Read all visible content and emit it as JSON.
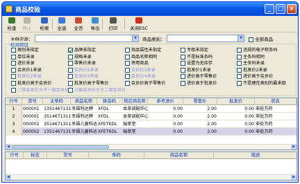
{
  "window": {
    "title": "商品校验",
    "buttons": {
      "minimize": "_",
      "maximize": "□",
      "close": "×"
    }
  },
  "toolbar": {
    "items": [
      {
        "label": "检查",
        "icon": "check-icon",
        "color": "#3a7a2a",
        "enabled": true
      },
      {
        "label": "停止",
        "icon": "stop-icon",
        "color": "#b8b5a6",
        "enabled": false
      },
      {
        "label": "检索",
        "icon": "search-icon",
        "color": "#2f62c7",
        "enabled": true
      },
      {
        "label": "全选",
        "icon": "select-all-icon",
        "color": "#3c7ad8",
        "enabled": true
      },
      {
        "label": "全否",
        "icon": "deselect-all-icon",
        "color": "#c94a3a",
        "enabled": true
      },
      {
        "label": "导出",
        "icon": "export-icon",
        "color": "#3f8fd0",
        "enabled": true
      },
      {
        "label": "打印",
        "icon": "print-icon",
        "color": "#555555",
        "enabled": true
      },
      {
        "label": "关闭ESC",
        "icon": "close-circle-icon",
        "color": "#d03020",
        "enabled": true
      }
    ]
  },
  "filters": {
    "supplier_label": "主供应商：",
    "supplier_value": "",
    "category_label": "商品类别：",
    "category_value": "",
    "all_goods_label": "全部商品",
    "all_goods_checked": false
  },
  "check_items": {
    "title": "检测项目",
    "options": [
      {
        "label": "类别未指定",
        "checked": false,
        "dim": false
      },
      {
        "label": "品牌未指定",
        "checked": true,
        "dim": false
      },
      {
        "label": "商品属性未指定",
        "checked": false,
        "dim": false
      },
      {
        "label": "专柜未指定",
        "checked": false,
        "dim": false
      },
      {
        "label": "违规的电子称条码",
        "checked": false,
        "dim": false
      },
      {
        "label": "单位未录",
        "checked": false,
        "dim": false
      },
      {
        "label": "规格未录",
        "checked": false,
        "dim": false
      },
      {
        "label": "商品名称相同",
        "checked": false,
        "dim": false
      },
      {
        "label": "不是标准条码",
        "checked": false,
        "dim": false
      },
      {
        "label": "主条码相同",
        "checked": false,
        "dim": false
      },
      {
        "label": "进价未录",
        "checked": false,
        "dim": false
      },
      {
        "label": "零售价未录",
        "checked": false,
        "dim": false
      },
      {
        "label": "停用商品",
        "checked": false,
        "dim": false
      },
      {
        "label": "设置为无库存",
        "checked": false,
        "dim": false
      },
      {
        "label": "主条码未录",
        "checked": false,
        "dim": false
      },
      {
        "label": "会员价1未录",
        "checked": false,
        "dim": false
      },
      {
        "label": "会员价2未录",
        "checked": false,
        "dim": true
      },
      {
        "label": "会员价3未录",
        "checked": false,
        "dim": true
      },
      {
        "label": "批发价1未录",
        "checked": false,
        "dim": false
      },
      {
        "label": "批发价2未录",
        "checked": false,
        "dim": false
      },
      {
        "label": "批发价2未录",
        "checked": false,
        "dim": true
      },
      {
        "label": "批发价3未录",
        "checked": false,
        "dim": true
      },
      {
        "label": "会员价4未录",
        "checked": false,
        "dim": true
      },
      {
        "label": "进价高于零售价",
        "checked": false,
        "dim": false
      },
      {
        "label": "进价高于会员价",
        "checked": false,
        "dim": false
      },
      {
        "label": "批发价高于会员价",
        "checked": false,
        "dim": false
      },
      {
        "label": "批发价高于零售价",
        "checked": false,
        "dim": false
      },
      {
        "label": "会员价高于零售价",
        "checked": false,
        "dim": false
      },
      {
        "label": "进价高于批发价",
        "checked": false,
        "dim": false
      },
      {
        "label": "不是建在类别的最末级",
        "checked": false,
        "dim": false
      },
      {
        "label": "二级会员价大于一级会员价",
        "checked": false,
        "dim": true
      },
      {
        "label": "三级会员价大于二级会员价",
        "checked": false,
        "dim": true
      }
    ]
  },
  "main_table": {
    "columns": [
      "行号",
      "货号",
      "主条码",
      "商品名称",
      "拼音码",
      "供应商名称",
      "参考进价",
      "零售价",
      "批发价",
      "状态"
    ],
    "rows": [
      [
        "1",
        "000001",
        "1351467131128",
        "幸福利达牌",
        "XFDL",
        "本草调配中心",
        "0.00",
        "2.00",
        "0.00",
        "非处方药"
      ],
      [
        "2",
        "000001",
        "351467131128",
        "幸福利达牌",
        "XFDL",
        "本草调配中心",
        "0.00",
        "2.00",
        "0.00",
        "非处方药"
      ],
      [
        "3",
        "000002",
        "351467131128",
        "幸福儿童科达牌",
        "XFETKDL",
        "瑞草堂",
        "0.00",
        "2.00",
        "0.00",
        "非处方药"
      ],
      [
        "4",
        "000002",
        "1351467131128",
        "幸福儿童科达牌",
        "XFETKDL",
        "瑞草堂",
        "0.00",
        "2.00",
        "0.00",
        "非处方药"
      ]
    ],
    "selected_row": 3
  },
  "detail_table": {
    "columns": [
      "行号",
      "标志",
      "货号",
      "条码",
      "商品名称",
      "描述"
    ]
  }
}
